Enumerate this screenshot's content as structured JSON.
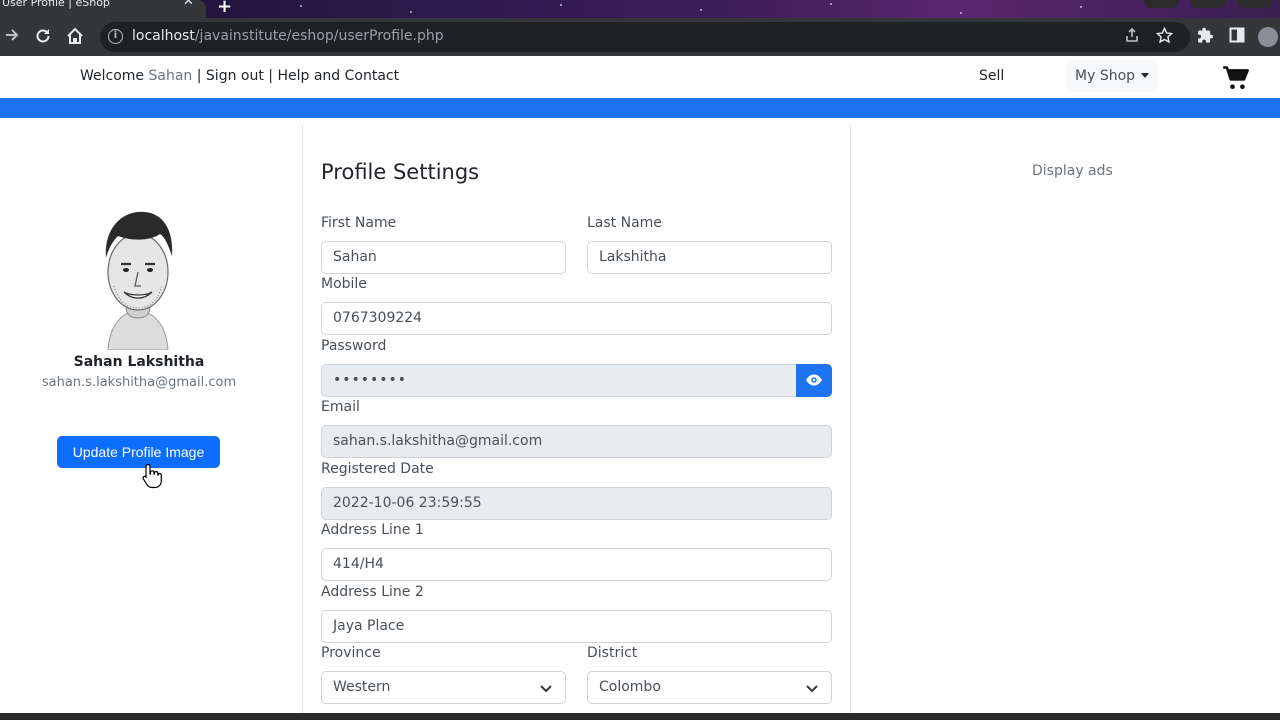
{
  "browser": {
    "tab_title": "User Profile | eShop",
    "url_host": "localhost",
    "url_path": "/javainstitute/eshop/userProfile.php"
  },
  "header": {
    "welcome_prefix": "Welcome ",
    "user_name": "Sahan",
    "sep1": " | ",
    "sign_out": "Sign out",
    "sep2": " | ",
    "help": "Help and Contact",
    "sell": "Sell",
    "my_shop": "My Shop",
    "cart_icon": "cart-icon"
  },
  "profile_card": {
    "name": "Sahan Lakshitha",
    "email": "sahan.s.lakshitha@gmail.com",
    "update_button": "Update Profile Image"
  },
  "form": {
    "title": "Profile Settings",
    "first_name_label": "First Name",
    "first_name": "Sahan",
    "last_name_label": "Last Name",
    "last_name": "Lakshitha",
    "mobile_label": "Mobile",
    "mobile": "0767309224",
    "password_label": "Password",
    "password": "••••••••",
    "email_label": "Email",
    "email": "sahan.s.lakshitha@gmail.com",
    "registered_label": "Registered Date",
    "registered": "2022-10-06 23:59:55",
    "address1_label": "Address Line 1",
    "address1": "414/H4",
    "address2_label": "Address Line 2",
    "address2": "Jaya Place",
    "province_label": "Province",
    "province": "Western",
    "district_label": "District",
    "district": "Colombo"
  },
  "ads": {
    "text": "Display ads"
  },
  "colors": {
    "accent": "#1e73f0",
    "primary_button": "#0d6efd",
    "readonly_bg": "#e9ecef"
  }
}
